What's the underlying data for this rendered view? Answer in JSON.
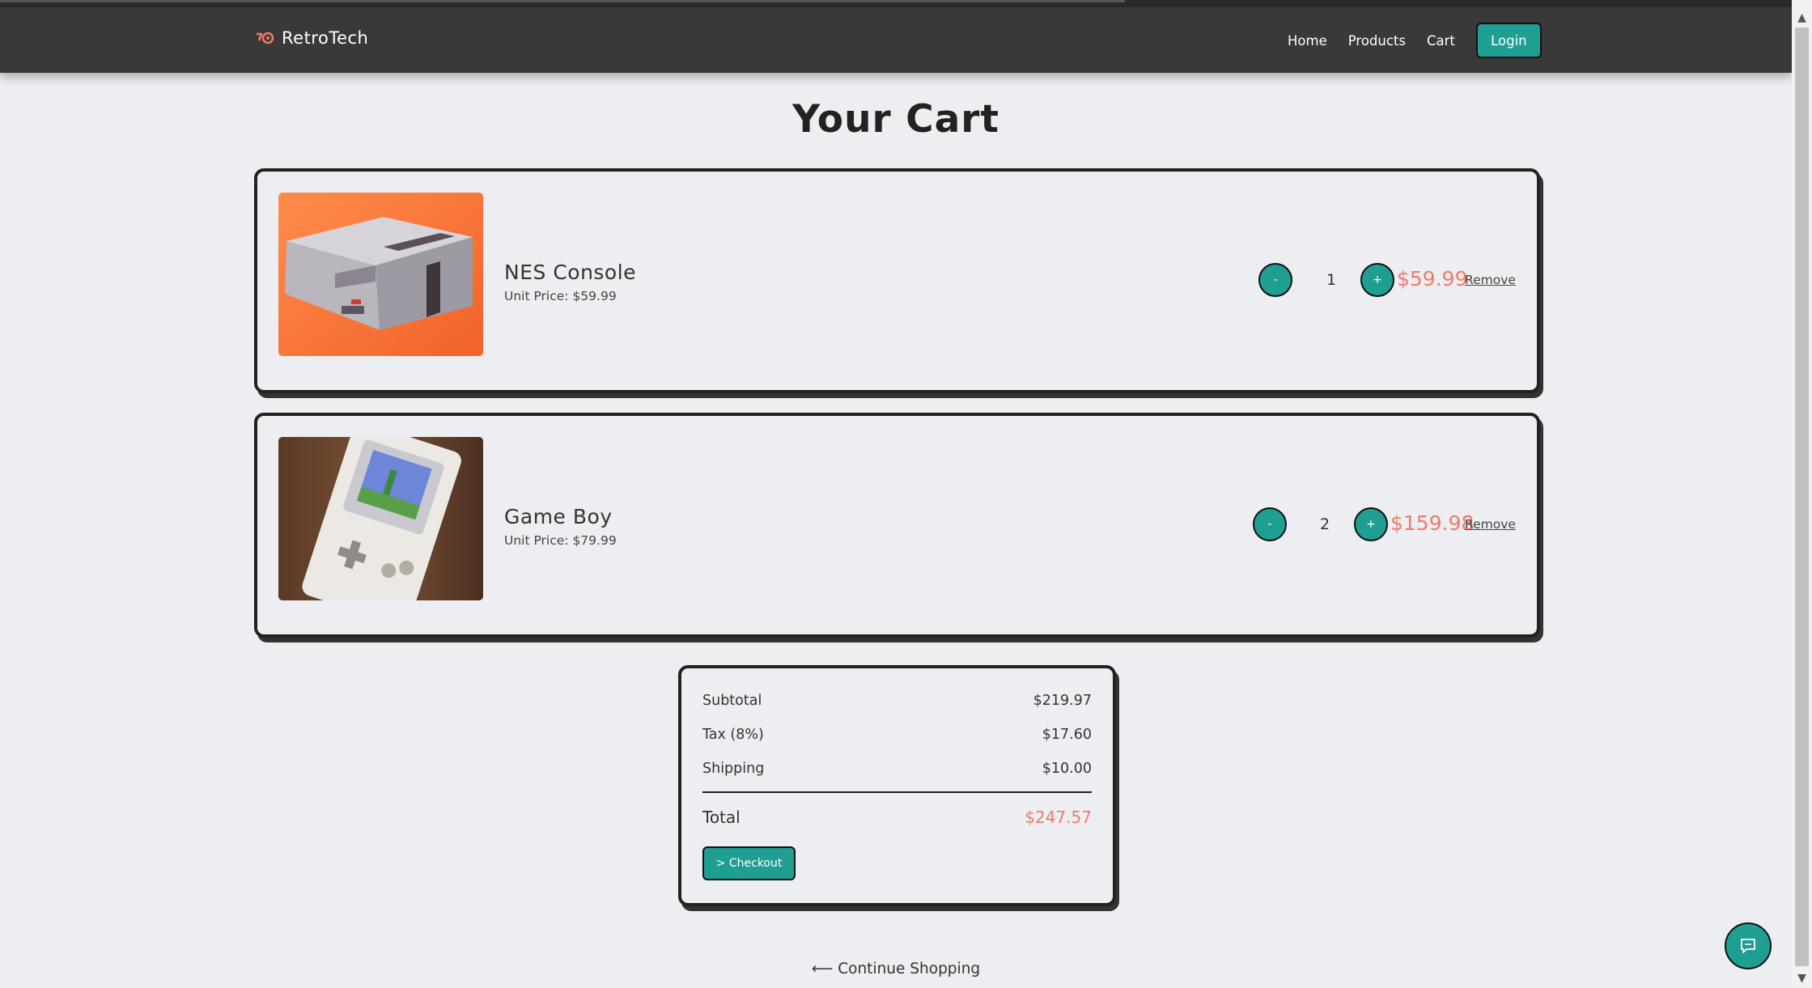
{
  "brand": {
    "name": "RetroTech",
    "icon": "retro-logo-icon"
  },
  "nav": {
    "links": [
      "Home",
      "Products",
      "Cart"
    ],
    "login_label": "Login"
  },
  "page_title": "Your Cart",
  "items": [
    {
      "name": "NES Console",
      "unit_price": "Unit Price: $59.99",
      "quantity": "1",
      "line_total": "$59.99",
      "decrement": "-",
      "increment": "+",
      "remove": "Remove",
      "image": "nes-console-photo"
    },
    {
      "name": "Game Boy",
      "unit_price": "Unit Price: $79.99",
      "quantity": "2",
      "line_total": "$159.98",
      "decrement": "-",
      "increment": "+",
      "remove": "Remove",
      "image": "game-boy-photo"
    }
  ],
  "summary": {
    "subtotal_label": "Subtotal",
    "subtotal": "$219.97",
    "tax_label": "Tax (8%)",
    "tax": "$17.60",
    "shipping_label": "Shipping",
    "shipping": "$10.00",
    "total_label": "Total",
    "total": "$247.57",
    "checkout_label": "> Checkout"
  },
  "continue_label": "⟵ Continue Shopping",
  "colors": {
    "accent": "#1f9e92",
    "price": "#f07a6a",
    "navbar": "#393939",
    "background": "#eceef1"
  }
}
